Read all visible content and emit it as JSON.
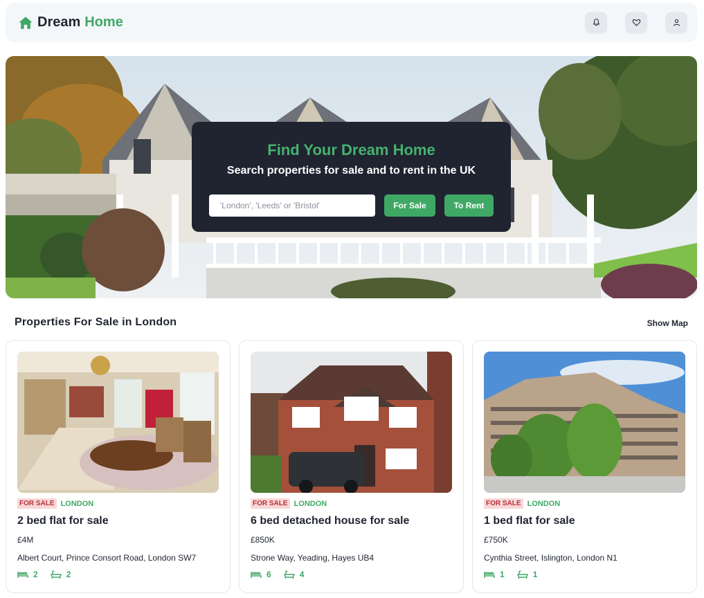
{
  "brand": {
    "name_part1": "Dream",
    "name_part2": "Home",
    "accent": "#3fa865",
    "icon": "home-icon"
  },
  "header_actions": [
    {
      "name": "notifications",
      "icon": "bell-icon"
    },
    {
      "name": "favorites",
      "icon": "heart-icon"
    },
    {
      "name": "account",
      "icon": "user-icon"
    }
  ],
  "hero": {
    "title": "Find Your Dream Home",
    "subtitle": "Search properties for sale and to rent in the UK",
    "search_placeholder": "'London', 'Leeds' or 'Bristol'",
    "search_value": "",
    "for_sale_label": "For Sale",
    "to_rent_label": "To Rent"
  },
  "section": {
    "title": "Properties For Sale in London",
    "show_map_label": "Show Map"
  },
  "listings": [
    {
      "status": "FOR SALE",
      "location": "LONDON",
      "title": "2 bed flat for sale",
      "price": "£4M",
      "address": "Albert Court, Prince Consort Road, London SW7",
      "beds": "2",
      "baths": "2",
      "image": "living-room-photo"
    },
    {
      "status": "FOR SALE",
      "location": "LONDON",
      "title": "6 bed detached house for sale",
      "price": "£850K",
      "address": "Strone Way, Yeading, Hayes UB4",
      "beds": "6",
      "baths": "4",
      "image": "brick-house-photo"
    },
    {
      "status": "FOR SALE",
      "location": "LONDON",
      "title": "1 bed flat for sale",
      "price": "£750K",
      "address": "Cynthia Street, Islington, London N1",
      "beds": "1",
      "baths": "1",
      "image": "apartment-building-photo"
    }
  ],
  "colors": {
    "dark": "#1f2430",
    "green": "#3fa865",
    "sale_tag_bg": "#f9d7d7",
    "sale_tag_text": "#b8323a"
  }
}
